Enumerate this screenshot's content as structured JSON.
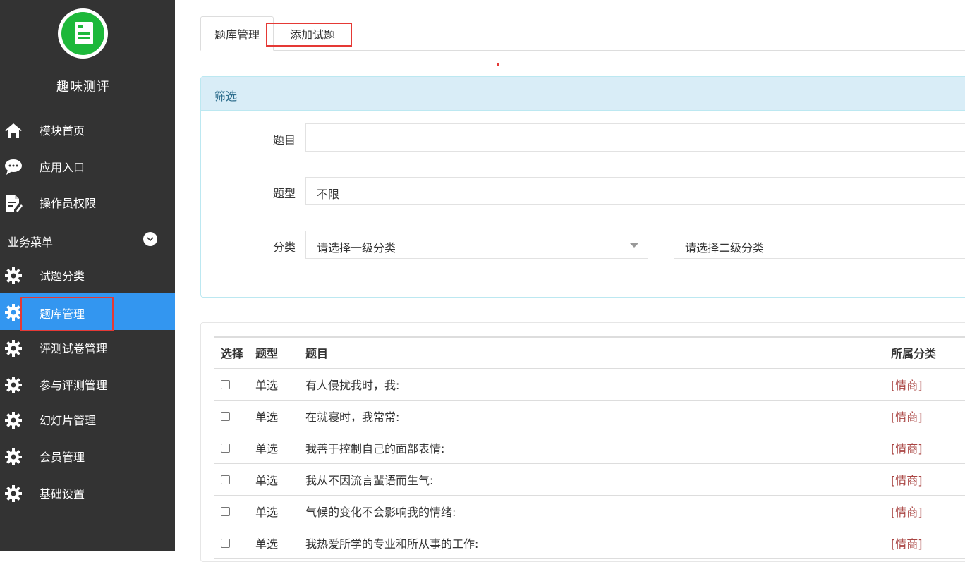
{
  "sidebar": {
    "brand": "趣味测评",
    "items_top": [
      {
        "label": "模块首页",
        "icon": "home-icon"
      },
      {
        "label": "应用入口",
        "icon": "chat-icon"
      },
      {
        "label": "操作员权限",
        "icon": "edit-document-icon"
      }
    ],
    "section_label": "业务菜单",
    "items": [
      {
        "label": "试题分类",
        "icon": "gear-icon"
      },
      {
        "label": "题库管理",
        "icon": "gear-icon",
        "active": true
      },
      {
        "label": "评测试卷管理",
        "icon": "gear-icon"
      },
      {
        "label": "参与评测管理",
        "icon": "gear-icon"
      },
      {
        "label": "幻灯片管理",
        "icon": "gear-icon"
      },
      {
        "label": "会员管理",
        "icon": "gear-icon"
      },
      {
        "label": "基础设置",
        "icon": "gear-icon"
      }
    ]
  },
  "tabs": [
    {
      "label": "题库管理",
      "active": true
    },
    {
      "label": "添加试题",
      "active": false
    }
  ],
  "filter": {
    "title": "筛选",
    "title_label": "题目",
    "title_value": "",
    "type_label": "题型",
    "type_value": "不限",
    "category_label": "分类",
    "category1_placeholder": "请选择一级分类",
    "category2_placeholder": "请选择二级分类"
  },
  "table": {
    "headers": [
      "选择",
      "题型",
      "题目",
      "所属分类"
    ],
    "rows": [
      {
        "type": "单选",
        "title": "有人侵扰我时，我:",
        "category": "[情商]"
      },
      {
        "type": "单选",
        "title": "在就寝时，我常常:",
        "category": "[情商]"
      },
      {
        "type": "单选",
        "title": "我善于控制自己的面部表情:",
        "category": "[情商]"
      },
      {
        "type": "单选",
        "title": "我从不因流言蜚语而生气:",
        "category": "[情商]"
      },
      {
        "type": "单选",
        "title": "气候的变化不会影响我的情绪:",
        "category": "[情商]"
      },
      {
        "type": "单选",
        "title": "我热爱所学的专业和所从事的工作:",
        "category": "[情商]"
      }
    ]
  },
  "colors": {
    "sidebar_bg": "#333333",
    "active_bg": "#3396f0",
    "highlight_box": "#e53935",
    "category_text": "#a94442",
    "filter_header_bg": "#d9edf7"
  }
}
